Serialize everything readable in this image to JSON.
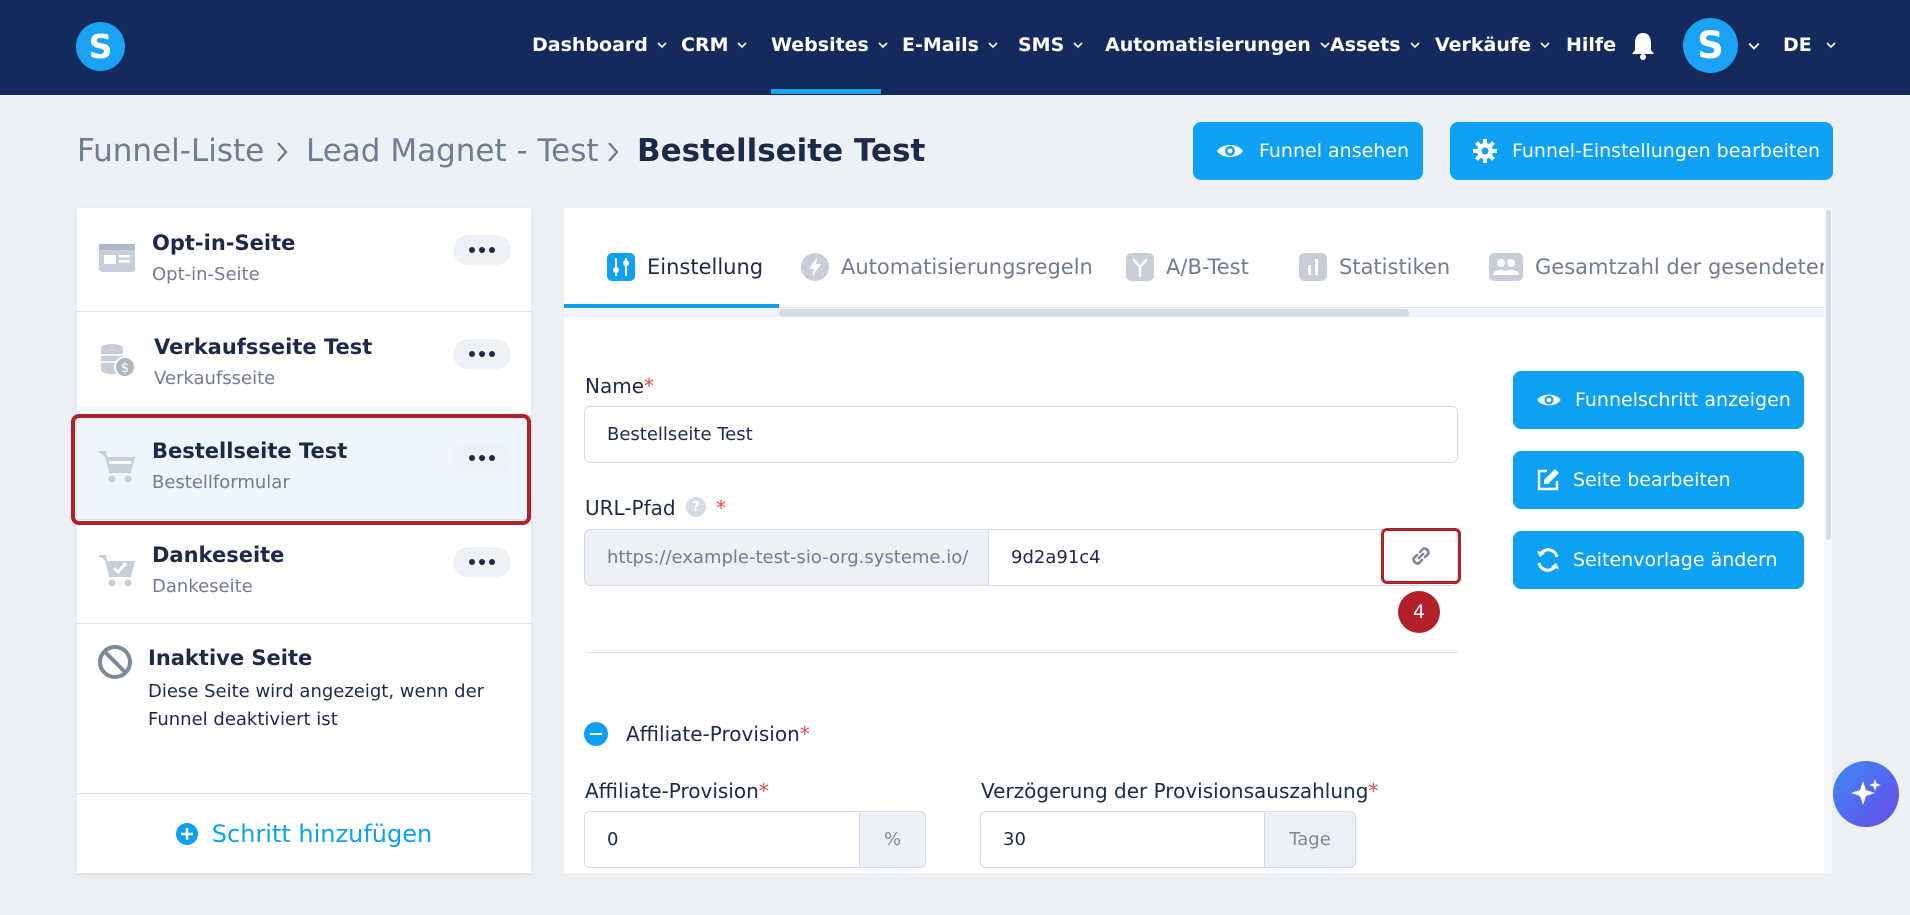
{
  "nav": {
    "logo_letter": "S",
    "items": [
      {
        "label": "Dashboard"
      },
      {
        "label": "CRM"
      },
      {
        "label": "Websites"
      },
      {
        "label": "E-Mails"
      },
      {
        "label": "SMS"
      },
      {
        "label": "Automatisierungen"
      },
      {
        "label": "Assets"
      },
      {
        "label": "Verkäufe"
      },
      {
        "label": "Hilfe"
      }
    ],
    "active": "Websites",
    "avatar_letter": "S",
    "language": "DE"
  },
  "breadcrumb": {
    "items": [
      "Funnel-Liste",
      "Lead Magnet - Test",
      "Bestellseite Test"
    ]
  },
  "header_buttons": {
    "view_funnel": "Funnel ansehen",
    "edit_funnel_settings": "Funnel-Einstellungen bearbeiten"
  },
  "sidebar": {
    "steps": [
      {
        "title": "Opt-in-Seite",
        "subtitle": "Opt-in-Seite",
        "icon": "optin-page-icon"
      },
      {
        "title": "Verkaufsseite Test",
        "subtitle": "Verkaufsseite",
        "icon": "coins-icon"
      },
      {
        "title": "Bestellseite Test",
        "subtitle": "Bestellformular",
        "icon": "cart-icon",
        "selected": true
      },
      {
        "title": "Dankeseite",
        "subtitle": "Dankeseite",
        "icon": "cart-check-icon"
      }
    ],
    "inactive": {
      "title": "Inaktive Seite",
      "line1": "Diese Seite wird angezeigt, wenn der",
      "line2": "Funnel deaktiviert ist"
    },
    "add_step": "Schritt hinzufügen"
  },
  "tabs": [
    {
      "label": "Einstellung",
      "icon": "sliders-icon",
      "active": true
    },
    {
      "label": "Automatisierungsregeln",
      "icon": "bolt-icon"
    },
    {
      "label": "A/B-Test",
      "icon": "split-icon"
    },
    {
      "label": "Statistiken",
      "icon": "bar-chart-icon"
    },
    {
      "label": "Gesamtzahl der gesendeten E",
      "icon": "users-icon"
    }
  ],
  "form": {
    "name_label": "Name",
    "name_value": "Bestellseite Test",
    "url_label": "URL-Pfad",
    "url_prefix": "https://example-test-sio-org.systeme.io/",
    "url_path": "9d2a91c4",
    "required_mark": "*",
    "help_mark": "?",
    "annotation_number": "4",
    "affiliate_section_label": "Affiliate-Provision",
    "affiliate_label": "Affiliate-Provision",
    "affiliate_value": "0",
    "affiliate_unit": "%",
    "delay_label": "Verzögerung der Provisionsauszahlung",
    "delay_value": "30",
    "delay_unit": "Tage"
  },
  "side_actions": {
    "show_step": "Funnelschritt anzeigen",
    "edit_page": "Seite bearbeiten",
    "change_template": "Seitenvorlage ändern"
  },
  "colors": {
    "nav_bg": "#142a5c",
    "accent": "#0ea0f2",
    "highlight": "#b2202b",
    "page_bg": "#edf1f6"
  }
}
